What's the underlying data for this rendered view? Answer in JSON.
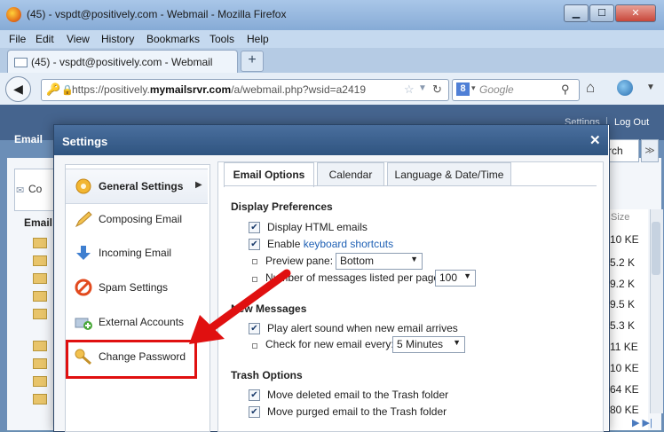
{
  "window": {
    "title": "(45) - vspdt@positively.com - Webmail - Mozilla Firefox",
    "min_glyph": "▁",
    "max_glyph": "☐",
    "close_glyph": "✕"
  },
  "menu": [
    "File",
    "Edit",
    "View",
    "History",
    "Bookmarks",
    "Tools",
    "Help"
  ],
  "tab": {
    "label": "(45) - vspdt@positively.com - Webmail",
    "new_tab": "+"
  },
  "nav": {
    "url_prefix": "https://positively.",
    "url_domain": "mymailsrvr.com",
    "url_suffix": "/a/webmail.php?wsid=a2419",
    "search_placeholder": "Google",
    "search_engine_letter": "8"
  },
  "webmail": {
    "settings_link": "Settings",
    "separator": "|",
    "logout_link": "Log Out",
    "email_tab": "Email",
    "bg_left_label": "Co",
    "bg_email_header": "Email",
    "search_fragment": "rch",
    "size_header": "Size",
    "sizes": [
      "10 KE",
      "5.2 K",
      "9.2 K",
      "9.5 K",
      "5.3 K",
      "11 KE",
      "10 KE",
      "64 KE",
      "80 KE"
    ],
    "pager": "▶ ▶|"
  },
  "dialog": {
    "title": "Settings",
    "close": "✕",
    "nav_items": [
      {
        "label": "General Settings",
        "icon": "gear-icon"
      },
      {
        "label": "Composing Email",
        "icon": "pencil-icon"
      },
      {
        "label": "Incoming Email",
        "icon": "download-arrow-icon"
      },
      {
        "label": "Spam Settings",
        "icon": "no-entry-icon"
      },
      {
        "label": "External Accounts",
        "icon": "add-account-icon"
      },
      {
        "label": "Change Password",
        "icon": "key-icon"
      }
    ],
    "tabs": [
      "Email Options",
      "Calendar",
      "Language & Date/Time"
    ],
    "display_prefs": {
      "heading": "Display Preferences",
      "html_emails": "Display HTML emails",
      "enable": "Enable ",
      "keyboard_shortcuts": "keyboard shortcuts",
      "preview_pane_label": "Preview pane:",
      "preview_pane_value": "Bottom",
      "messages_per_page_label": "Number of messages listed per page:",
      "messages_per_page_value": "100"
    },
    "new_messages": {
      "heading": "New Messages",
      "alert_sound": "Play alert sound when new email arrives",
      "check_every_label": "Check for new email every:",
      "check_every_value": "5 Minutes"
    },
    "trash": {
      "heading": "Trash Options",
      "move_deleted": "Move deleted email to the Trash folder",
      "move_purged": "Move purged email to the Trash folder"
    }
  },
  "colors": {
    "highlight": "#e01010",
    "link": "#1d5fb4",
    "header": "#2f5480"
  }
}
